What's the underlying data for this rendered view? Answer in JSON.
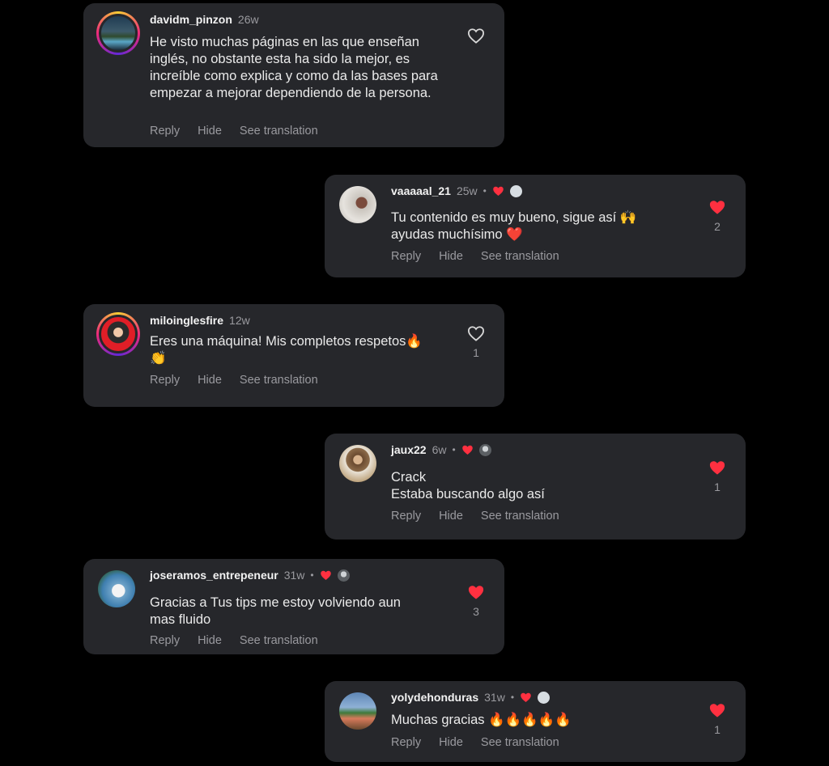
{
  "comments": [
    {
      "username": "davidm_pinzon",
      "time": "26w",
      "text": "He visto muchas páginas en las que enseñan inglés, no obstante esta ha sido la mejor, es increíble como explica y como da las bases para empezar a mejorar dependiendo de la persona.",
      "likes": "",
      "liked": false,
      "creator_liked": false,
      "avatar": "landscape-avatar",
      "actions": {
        "reply": "Reply",
        "hide": "Hide",
        "translate": "See translation"
      }
    },
    {
      "username": "vaaaaal_21",
      "time": "25w",
      "text_line1": "Tu contenido es muy bueno, sigue así 🙌",
      "text_line2": "ayudas muchísimo ❤️",
      "likes": "2",
      "liked": true,
      "creator_liked": true,
      "avatar": "person-avatar",
      "actions": {
        "reply": "Reply",
        "hide": "Hide",
        "translate": "See translation"
      }
    },
    {
      "username": "miloinglesfire",
      "time": "12w",
      "text_line1": "Eres una máquina! Mis completos respetos🔥",
      "text_line2": "👏",
      "likes": "1",
      "liked": false,
      "creator_liked": false,
      "avatar": "red-avatar",
      "actions": {
        "reply": "Reply",
        "hide": "Hide",
        "translate": "See translation"
      }
    },
    {
      "username": "jaux22",
      "time": "6w",
      "text_line1": "Crack",
      "text_line2": "Estaba buscando algo así",
      "likes": "1",
      "liked": true,
      "creator_liked": true,
      "avatar": "person-avatar",
      "actions": {
        "reply": "Reply",
        "hide": "Hide",
        "translate": "See translation"
      }
    },
    {
      "username": "joseramos_entrepeneur",
      "time": "31w",
      "text_line1": "Gracias a Tus tips me estoy volviendo aun",
      "text_line2": "mas fluido",
      "likes": "3",
      "liked": true,
      "creator_liked": true,
      "avatar": "person-avatar",
      "actions": {
        "reply": "Reply",
        "hide": "Hide",
        "translate": "See translation"
      }
    },
    {
      "username": "yolydehonduras",
      "time": "31w",
      "text": "Muchas gracias 🔥🔥🔥🔥🔥",
      "likes": "1",
      "liked": true,
      "creator_liked": true,
      "avatar": "person-avatar",
      "actions": {
        "reply": "Reply",
        "hide": "Hide",
        "translate": "See translation"
      }
    }
  ],
  "colors": {
    "background": "#000000",
    "card": "#26272b",
    "heart_red": "#ff3040",
    "muted_text": "#9a9a9f",
    "primary_text": "#eaeaea"
  }
}
